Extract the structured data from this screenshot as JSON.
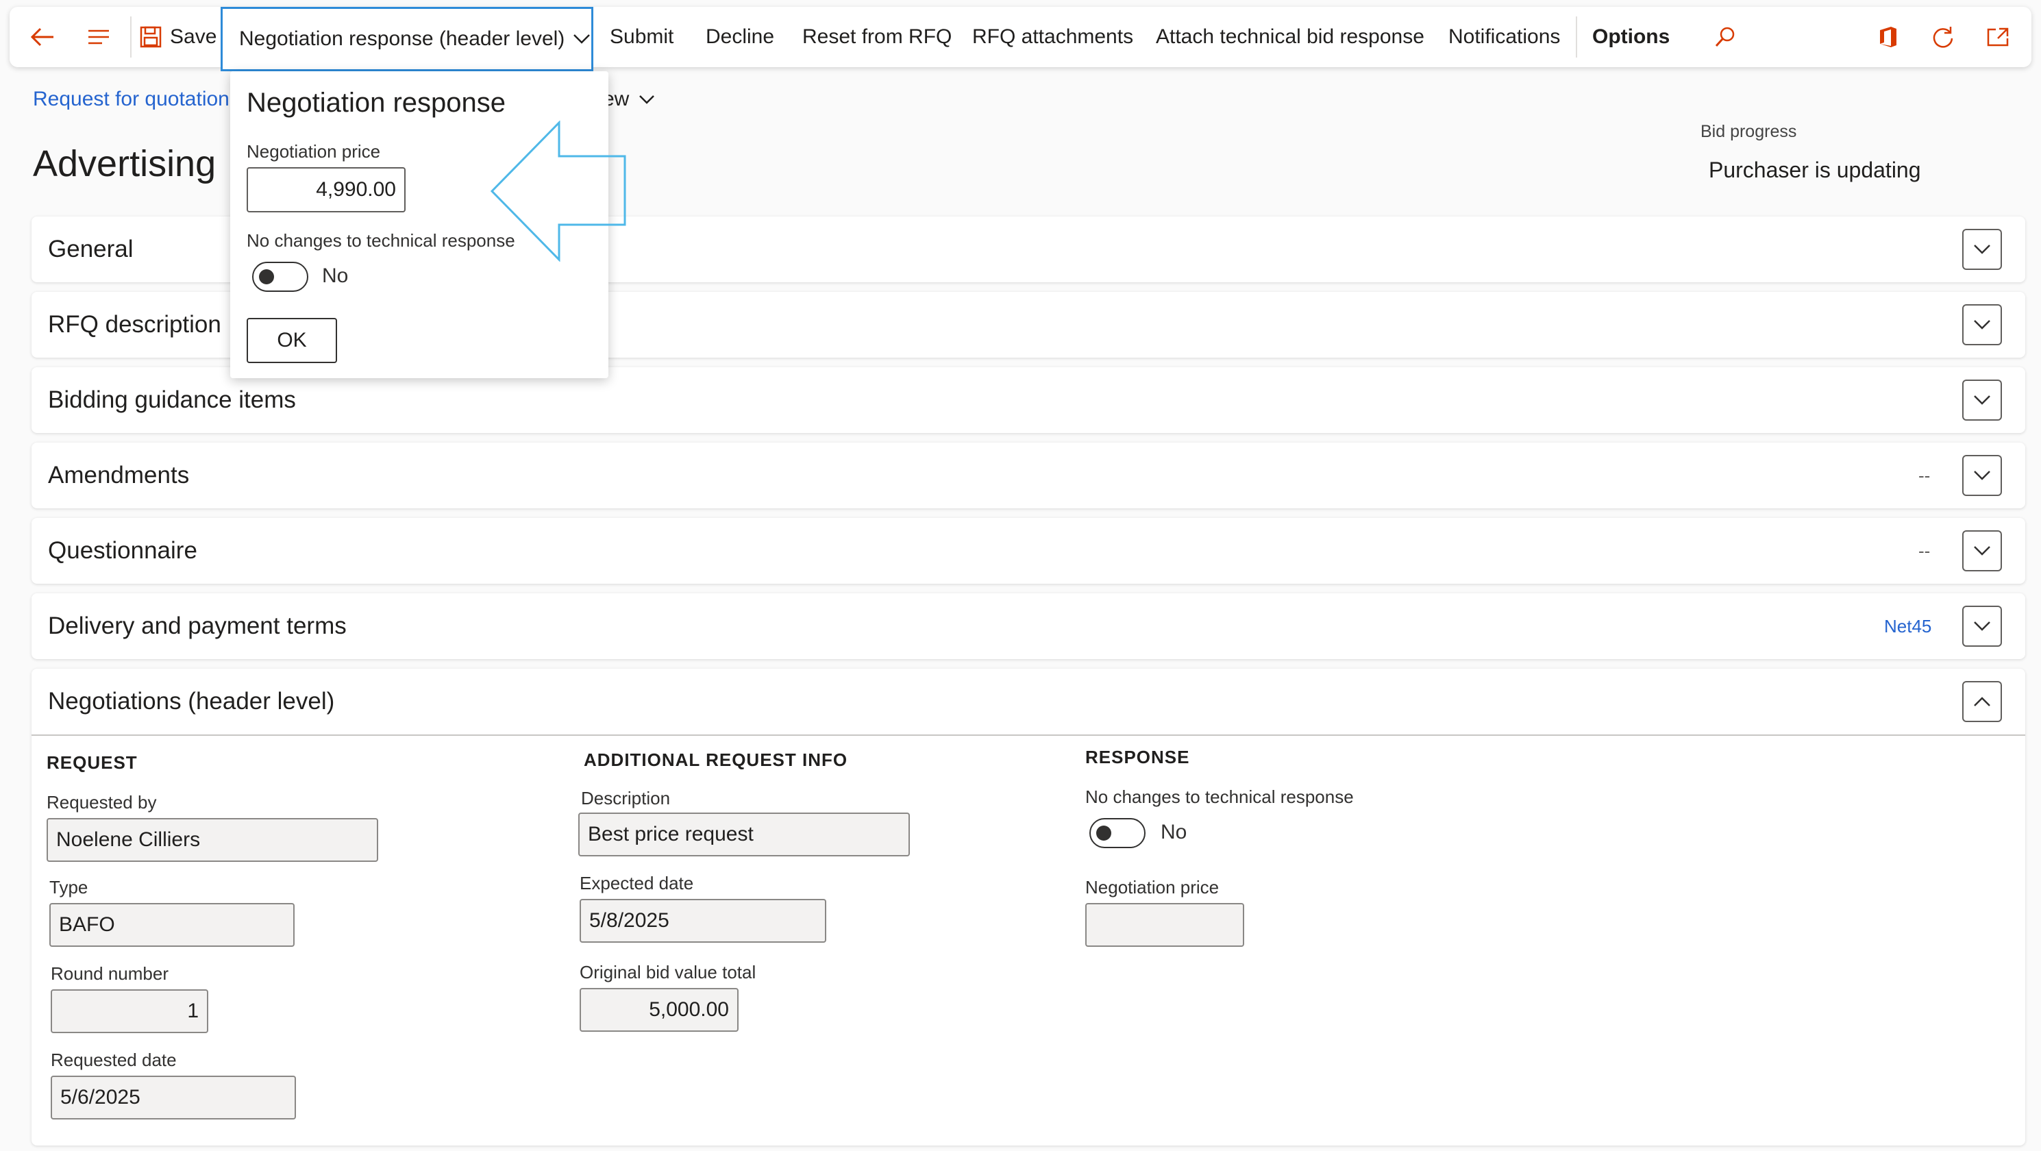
{
  "action_pane": {
    "save": "Save",
    "active_menu": "Negotiation response (header level)",
    "items": [
      "Submit",
      "Decline",
      "Reset from RFQ",
      "RFQ attachments",
      "Attach technical bid response",
      "Notifications"
    ],
    "options": "Options",
    "icons": [
      "back-arrow-icon",
      "menu-lines-icon",
      "save-icon",
      "chevron-down-icon",
      "search-icon",
      "office-icon",
      "refresh-icon",
      "open-new-window-icon"
    ]
  },
  "header": {
    "breadcrumb": "Request for quotation",
    "view_menu": "ew",
    "title": "Advertising",
    "bid_progress_label": "Bid progress",
    "bid_progress_value": "Purchaser is updating"
  },
  "fasttabs": [
    {
      "title": "General",
      "summary": ""
    },
    {
      "title": "RFQ description",
      "summary": ""
    },
    {
      "title": "Bidding guidance items",
      "summary": ""
    },
    {
      "title": "Amendments",
      "summary": "--"
    },
    {
      "title": "Questionnaire",
      "summary": "--"
    },
    {
      "title": "Delivery and payment terms",
      "summary": "Net45"
    }
  ],
  "negotiations": {
    "title": "Negotiations (header level)",
    "request": {
      "group": "REQUEST",
      "requested_by_label": "Requested by",
      "requested_by": "Noelene Cilliers",
      "type_label": "Type",
      "type": "BAFO",
      "round_label": "Round number",
      "round": "1",
      "requested_date_label": "Requested date",
      "requested_date": "5/6/2025"
    },
    "additional": {
      "group": "ADDITIONAL REQUEST INFO",
      "description_label": "Description",
      "description": "Best price request",
      "expected_date_label": "Expected date",
      "expected_date": "5/8/2025",
      "original_total_label": "Original bid value total",
      "original_total": "5,000.00"
    },
    "response": {
      "group": "RESPONSE",
      "no_changes_label": "No changes to technical response",
      "no_changes_value": "No",
      "price_label": "Negotiation price",
      "price": ""
    }
  },
  "flyout": {
    "title": "Negotiation response",
    "price_label": "Negotiation price",
    "price": "4,990.00",
    "no_changes_label": "No changes to technical response",
    "no_changes_value": "No",
    "ok": "OK"
  },
  "colors": {
    "accent_blue": "#2564cf",
    "active_border": "#2e8bd8",
    "callout_arrow": "#4fb8e8",
    "office_red": "#d83b01"
  }
}
